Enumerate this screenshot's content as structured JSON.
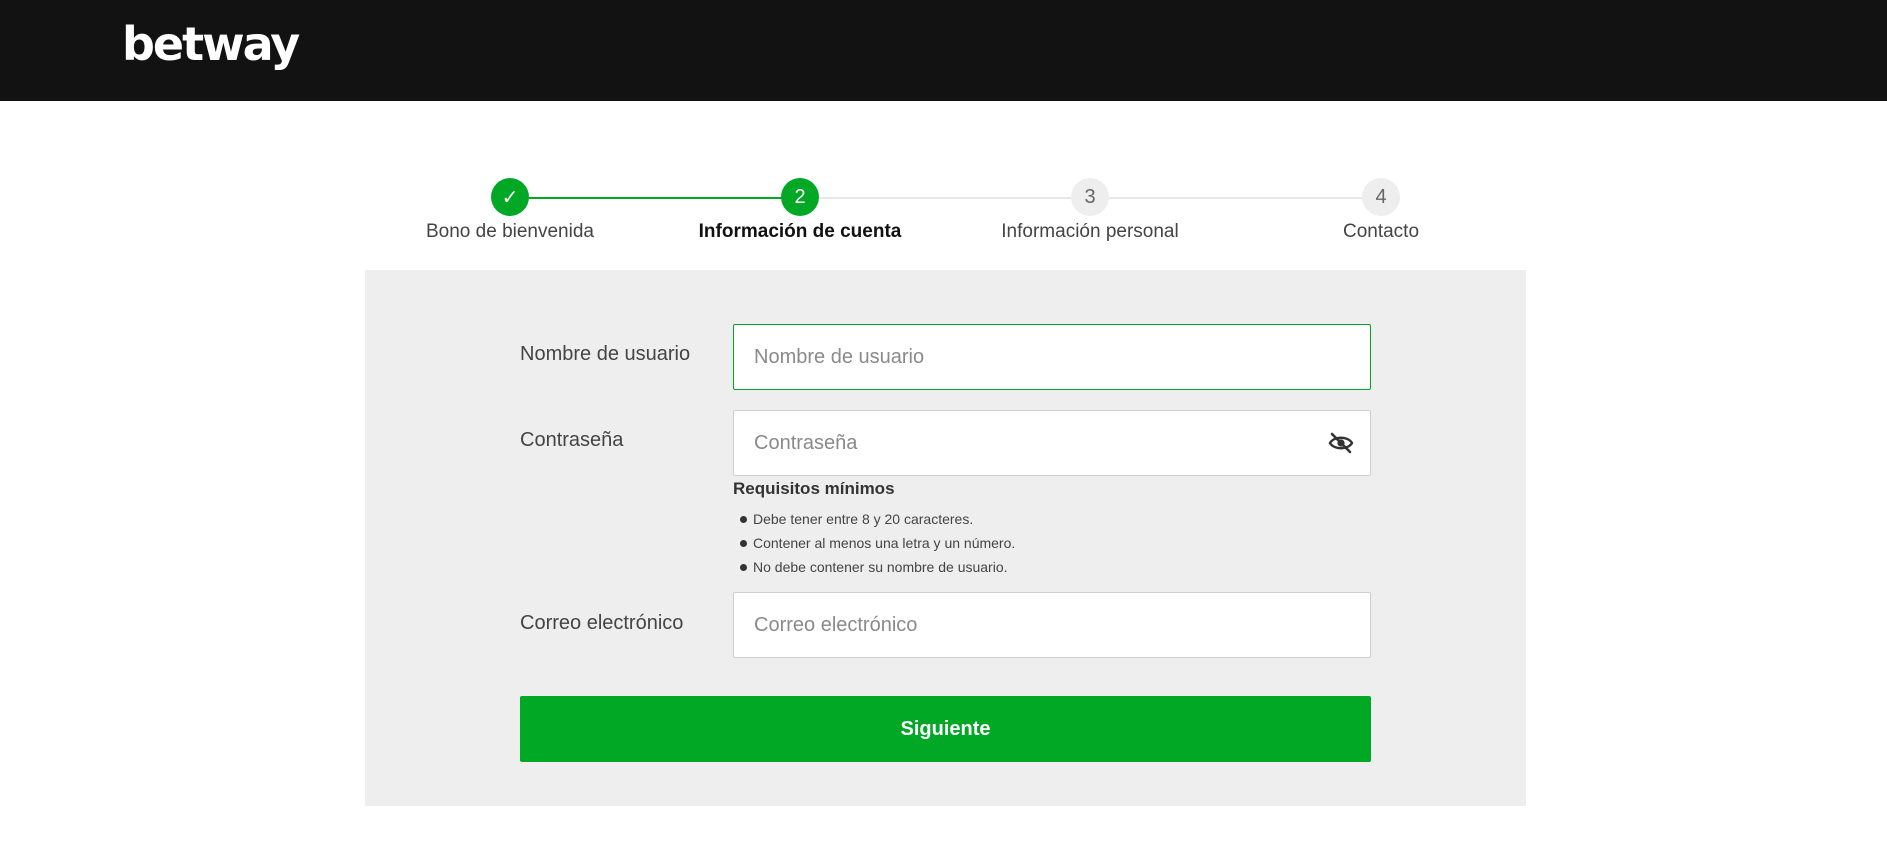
{
  "header": {
    "logo_text": "betway"
  },
  "stepper": {
    "steps": [
      {
        "label": "Bono de bienvenida",
        "marker": "✓",
        "state": "done"
      },
      {
        "label": "Información de cuenta",
        "marker": "2",
        "state": "active"
      },
      {
        "label": "Información personal",
        "marker": "3",
        "state": "todo"
      },
      {
        "label": "Contacto",
        "marker": "4",
        "state": "todo"
      }
    ]
  },
  "form": {
    "username": {
      "label": "Nombre de usuario",
      "placeholder": "Nombre de usuario",
      "value": ""
    },
    "password": {
      "label": "Contraseña",
      "placeholder": "Contraseña",
      "value": "",
      "toggle_icon": "eye-slash-icon"
    },
    "requirements": {
      "title": "Requisitos mínimos",
      "items": [
        "Debe tener entre 8 y 20 caracteres.",
        "Contener al menos una letra y un número.",
        "No debe contener su nombre de usuario."
      ]
    },
    "email": {
      "label": "Correo electrónico",
      "placeholder": "Correo electrónico",
      "value": ""
    },
    "submit_label": "Siguiente"
  },
  "colors": {
    "header_bg": "#121212",
    "brand_green": "#00a826",
    "panel_bg": "#eeeeee",
    "inactive_step": "#eeeeee"
  }
}
